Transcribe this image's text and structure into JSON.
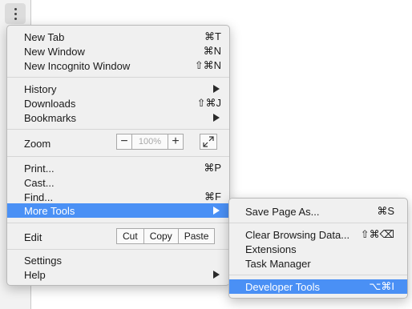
{
  "main_menu": {
    "new_tab": {
      "label": "New Tab",
      "shortcut": "⌘T"
    },
    "new_window": {
      "label": "New Window",
      "shortcut": "⌘N"
    },
    "new_incognito": {
      "label": "New Incognito Window",
      "shortcut": "⇧⌘N"
    },
    "history": {
      "label": "History"
    },
    "downloads": {
      "label": "Downloads",
      "shortcut": "⇧⌘J"
    },
    "bookmarks": {
      "label": "Bookmarks"
    },
    "zoom": {
      "label": "Zoom",
      "minus": "−",
      "value": "100%",
      "plus": "+"
    },
    "print": {
      "label": "Print...",
      "shortcut": "⌘P"
    },
    "cast": {
      "label": "Cast..."
    },
    "find": {
      "label": "Find...",
      "shortcut": "⌘F"
    },
    "more_tools": {
      "label": "More Tools"
    },
    "edit": {
      "label": "Edit",
      "cut": "Cut",
      "copy": "Copy",
      "paste": "Paste"
    },
    "settings": {
      "label": "Settings"
    },
    "help": {
      "label": "Help"
    }
  },
  "sub_menu": {
    "save_page": {
      "label": "Save Page As...",
      "shortcut": "⌘S"
    },
    "clear_browsing": {
      "label": "Clear Browsing Data...",
      "shortcut": "⇧⌘⌫"
    },
    "extensions": {
      "label": "Extensions"
    },
    "task_manager": {
      "label": "Task Manager"
    },
    "developer_tools": {
      "label": "Developer Tools",
      "shortcut": "⌥⌘I"
    }
  },
  "colors": {
    "highlight": "#4a90f5",
    "menu_bg": "#f0f0f0"
  },
  "icons": {
    "menu_button": "kebab-icon",
    "fullscreen": "fullscreen-icon",
    "submenu": "chevron-right-icon"
  }
}
